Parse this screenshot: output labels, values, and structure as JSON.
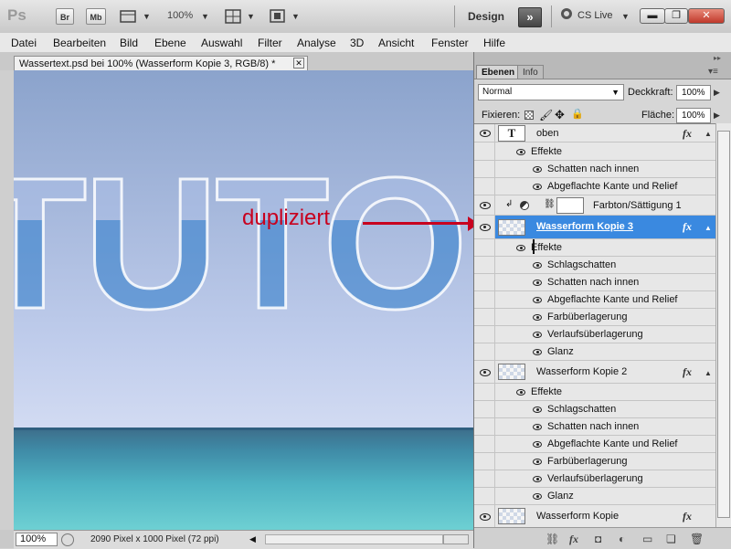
{
  "appbar": {
    "logo": "Ps",
    "btn_br": "Br",
    "btn_mb": "Mb",
    "zoom": "100%",
    "workspace": "Design",
    "cslive": "CS Live"
  },
  "menu": [
    "Datei",
    "Bearbeiten",
    "Bild",
    "Ebene",
    "Auswahl",
    "Filter",
    "Analyse",
    "3D",
    "Ansicht",
    "Fenster",
    "Hilfe"
  ],
  "document": {
    "tab_title": "Wassertext.psd bei 100% (Wasserform Kopie 3, RGB/8) *",
    "canvas_text": "TUTO",
    "annotation": "dupliziert",
    "status_zoom": "100%",
    "status_info": "2090 Pixel x 1000 Pixel (72 ppi)"
  },
  "panel": {
    "tabs": [
      "Ebenen",
      "Info"
    ],
    "blend_mode": "Normal",
    "opacity_label": "Deckkraft:",
    "opacity": "100%",
    "lock_label": "Fixieren:",
    "fill_label": "Fläche:",
    "fill": "100%",
    "layers": [
      {
        "name": "oben"
      },
      {
        "name": "Effekte"
      },
      {
        "name": "Schatten nach innen"
      },
      {
        "name": "Abgeflachte Kante und Relief"
      },
      {
        "name": "Farbton/Sättigung 1"
      },
      {
        "name": "Wasserform Kopie 3"
      },
      {
        "name": "Effekte"
      },
      {
        "name": "Schlagschatten"
      },
      {
        "name": "Schatten nach innen"
      },
      {
        "name": "Abgeflachte Kante und Relief"
      },
      {
        "name": "Farbüberlagerung"
      },
      {
        "name": "Verlaufsüberlagerung"
      },
      {
        "name": "Glanz"
      },
      {
        "name": "Wasserform Kopie 2"
      },
      {
        "name": "Effekte"
      },
      {
        "name": "Schlagschatten"
      },
      {
        "name": "Schatten nach innen"
      },
      {
        "name": "Abgeflachte Kante und Relief"
      },
      {
        "name": "Farbüberlagerung"
      },
      {
        "name": "Verlaufsüberlagerung"
      },
      {
        "name": "Glanz"
      },
      {
        "name": "Wasserform Kopie"
      }
    ]
  },
  "colors": {
    "selected": "#3a89e0",
    "annotation": "#c8001e"
  }
}
